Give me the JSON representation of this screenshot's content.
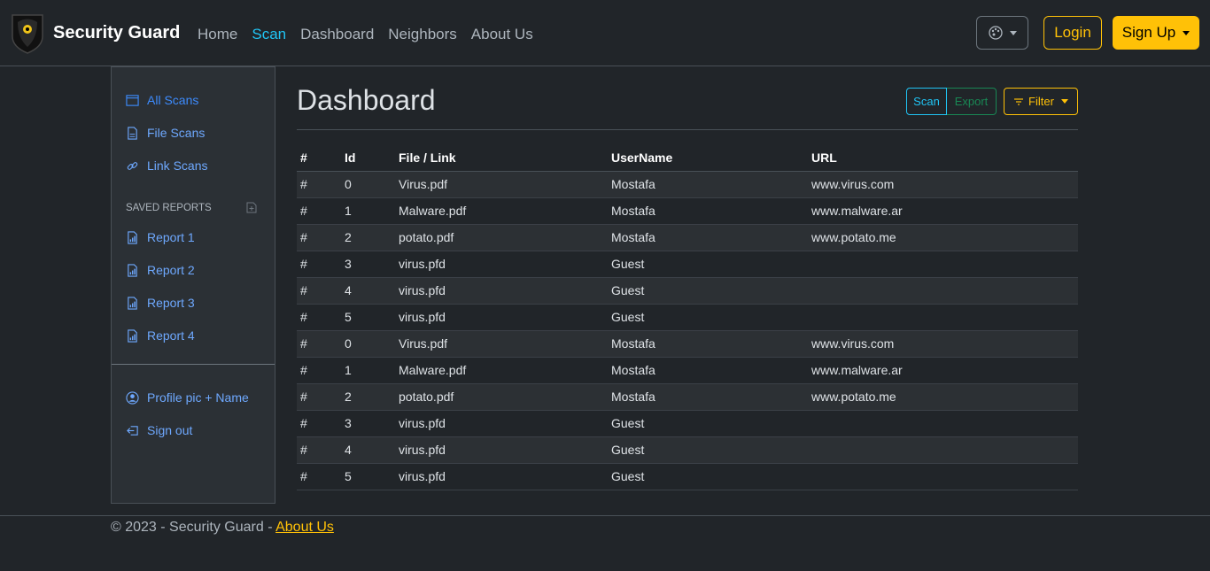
{
  "brand": {
    "name": "Security Guard"
  },
  "nav": {
    "items": [
      "Home",
      "Scan",
      "Dashboard",
      "Neighbors",
      "About Us"
    ],
    "active_index": 1
  },
  "header_actions": {
    "login": "Login",
    "signup": "Sign Up"
  },
  "sidebar": {
    "items": [
      {
        "label": "All Scans",
        "icon": "browser-icon"
      },
      {
        "label": "File Scans",
        "icon": "file-icon"
      },
      {
        "label": "Link Scans",
        "icon": "link-icon"
      }
    ],
    "saved_heading": "SAVED REPORTS",
    "reports": [
      {
        "label": "Report 1",
        "icon": "report-icon"
      },
      {
        "label": "Report 2",
        "icon": "report-icon"
      },
      {
        "label": "Report 3",
        "icon": "report-icon"
      },
      {
        "label": "Report 4",
        "icon": "report-icon"
      }
    ],
    "profile": "Profile pic + Name",
    "signout": "Sign out"
  },
  "main": {
    "title": "Dashboard",
    "scan_btn": "Scan",
    "export_btn": "Export",
    "filter_btn": "Filter"
  },
  "table": {
    "headers": [
      "#",
      "Id",
      "File / Link",
      "UserName",
      "URL"
    ],
    "rows": [
      [
        "#",
        "0",
        "Virus.pdf",
        "Mostafa",
        "www.virus.com"
      ],
      [
        "#",
        "1",
        "Malware.pdf",
        "Mostafa",
        "www.malware.ar"
      ],
      [
        "#",
        "2",
        "potato.pdf",
        "Mostafa",
        "www.potato.me"
      ],
      [
        "#",
        "3",
        "virus.pfd",
        "Guest",
        ""
      ],
      [
        "#",
        "4",
        "virus.pfd",
        "Guest",
        ""
      ],
      [
        "#",
        "5",
        "virus.pfd",
        "Guest",
        ""
      ],
      [
        "#",
        "0",
        "Virus.pdf",
        "Mostafa",
        "www.virus.com"
      ],
      [
        "#",
        "1",
        "Malware.pdf",
        "Mostafa",
        "www.malware.ar"
      ],
      [
        "#",
        "2",
        "potato.pdf",
        "Mostafa",
        "www.potato.me"
      ],
      [
        "#",
        "3",
        "virus.pfd",
        "Guest",
        ""
      ],
      [
        "#",
        "4",
        "virus.pfd",
        "Guest",
        ""
      ],
      [
        "#",
        "5",
        "virus.pfd",
        "Guest",
        ""
      ]
    ]
  },
  "footer": {
    "text": "© 2023 - Security Guard - ",
    "link": "About Us"
  },
  "colors": {
    "accent": "#ffc107",
    "info": "#20c4f4",
    "success": "#198754",
    "link": "#6ea8fe"
  }
}
